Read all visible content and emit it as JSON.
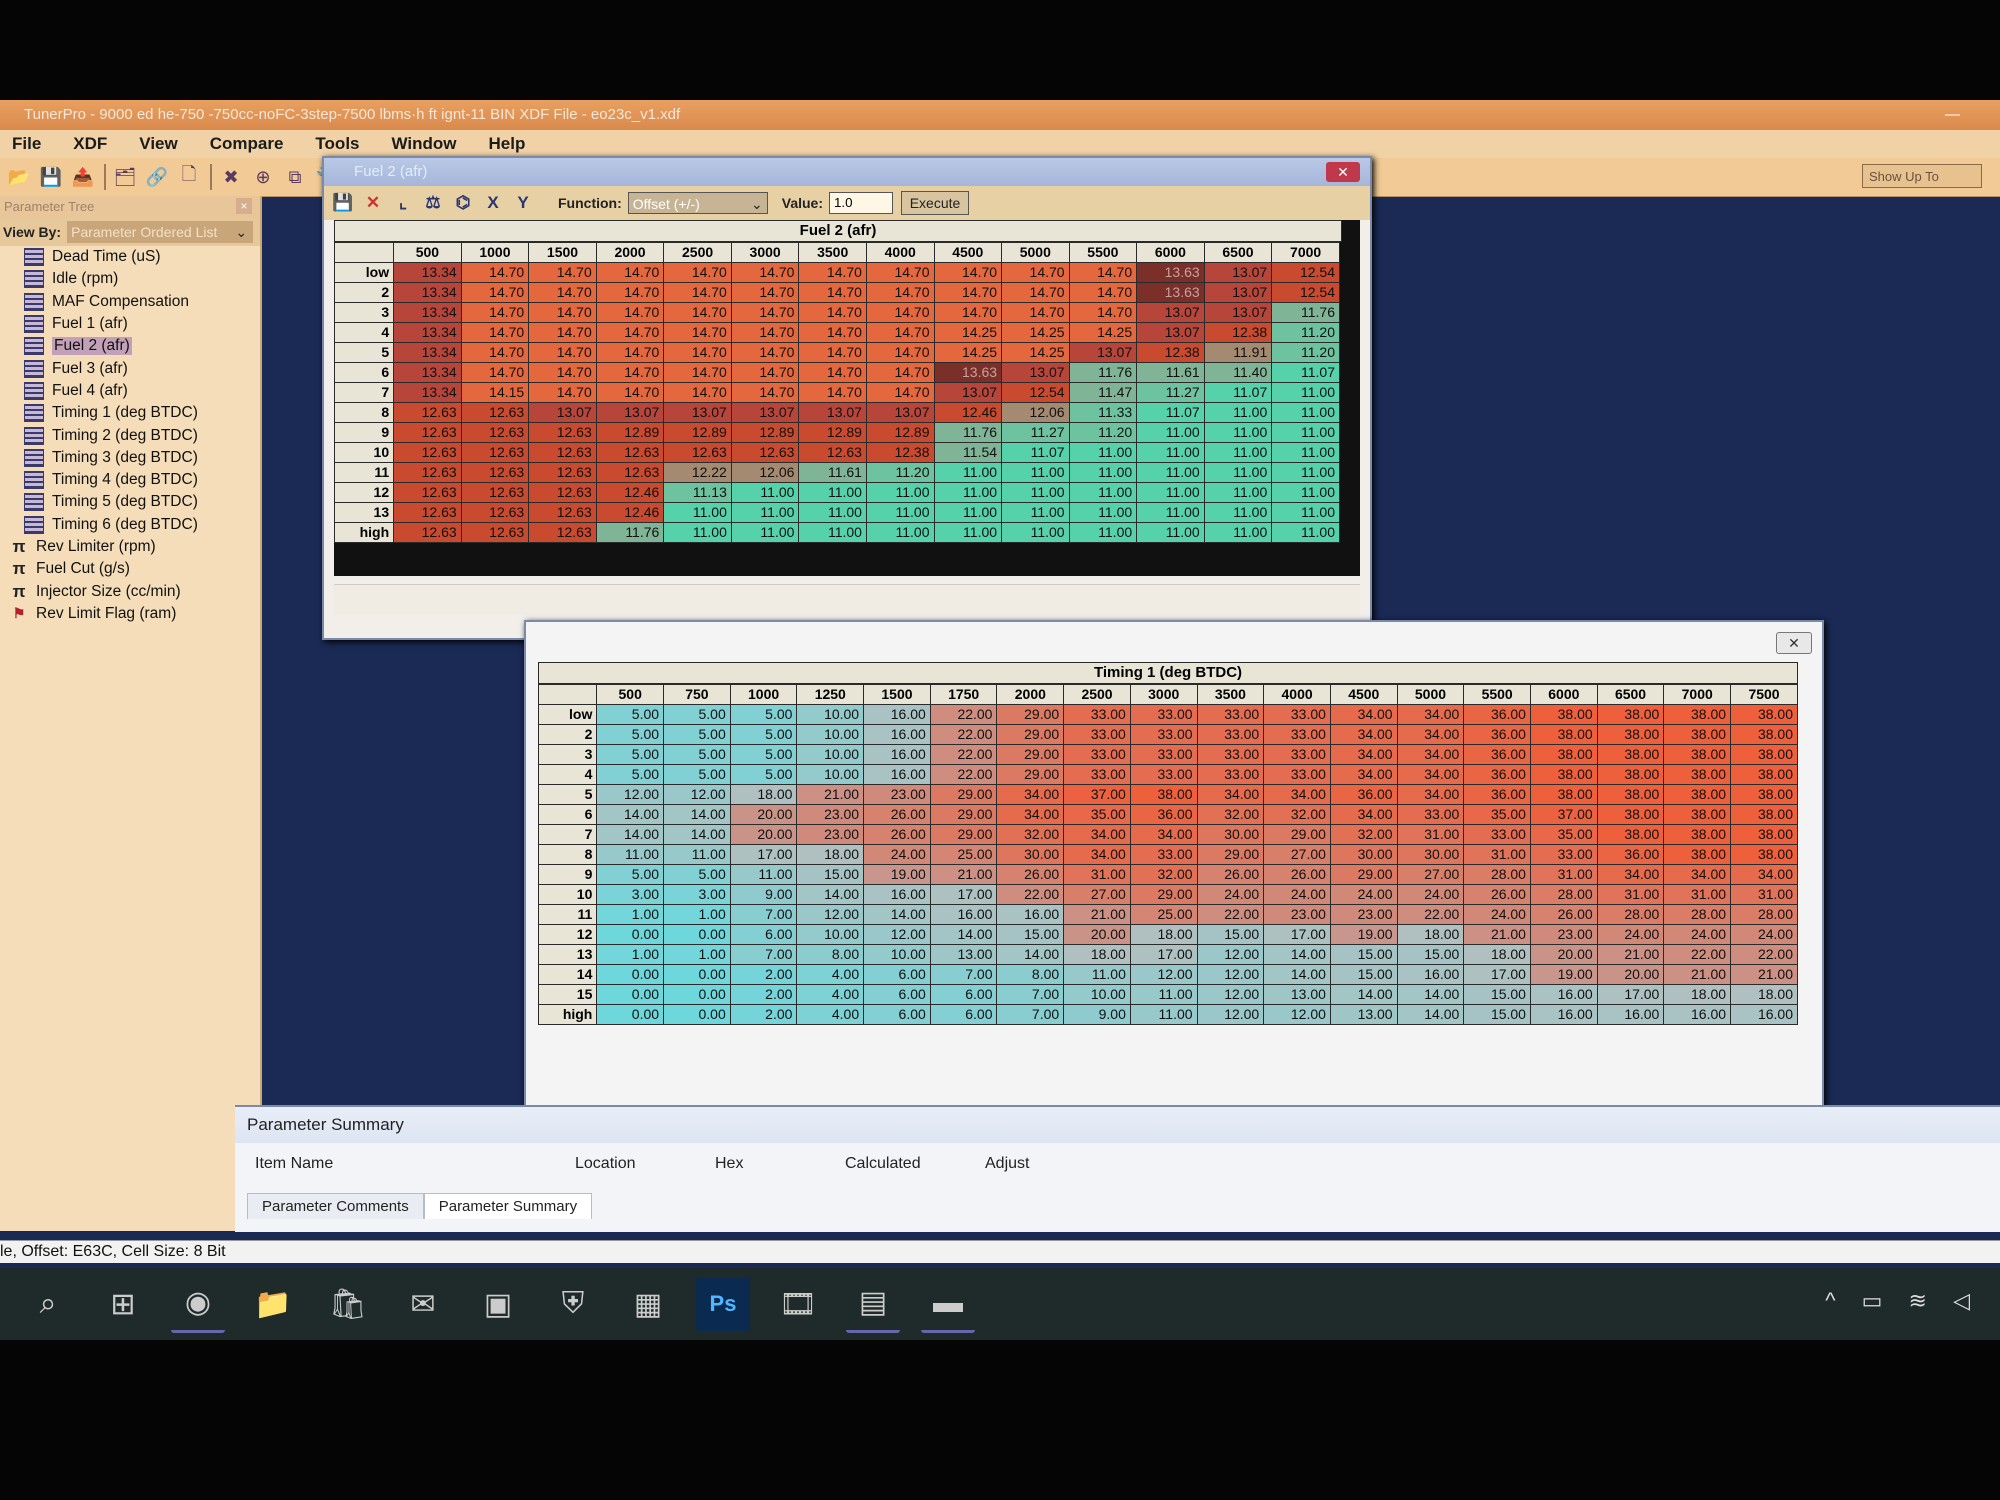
{
  "app": {
    "title": "TunerPro - 9000 ed  he-750 -750cc-noFC-3step-7500 lbms·h ft ignt-11 BIN  XDF File - eo23c_v1.xdf",
    "minimize": "—"
  },
  "menu": [
    "File",
    "XDF",
    "View",
    "Compare",
    "Tools",
    "Window",
    "Help"
  ],
  "toolbar": {
    "icons": [
      "open-icon",
      "save-icon",
      "export-icon",
      "sep",
      "import-icon",
      "link-icon",
      "new-icon",
      "sep",
      "delete-icon",
      "add-icon",
      "copy-icon",
      "wrench-icon",
      "page-icon",
      "sep",
      "table-view-icon",
      "list-view-icon",
      "window-icon",
      "monitor-icon",
      "sep",
      "counter-icon",
      "search-icon",
      "compare-icon",
      "grid-icon",
      "chip-icon"
    ],
    "glyphs": [
      "📂",
      "💾",
      "📤",
      "|",
      "🗂",
      "🔗",
      "🗋",
      "|",
      "✖",
      "⊕",
      "⧉",
      "🔧",
      "🗍",
      "|",
      "▦",
      "☰",
      "▣",
      "🖥",
      "|",
      "▤",
      "🔍",
      "⚖",
      "▩",
      "▥"
    ],
    "show_up_to": "Show Up To"
  },
  "sidebar": {
    "title": "Parameter Tree",
    "close": "×",
    "view_by_label": "View By:",
    "view_by_value": "Parameter Ordered List",
    "items": [
      {
        "label": "Dead Time (uS)",
        "type": "table"
      },
      {
        "label": "Idle (rpm)",
        "type": "table"
      },
      {
        "label": "MAF Compensation",
        "type": "table"
      },
      {
        "label": "Fuel 1 (afr)",
        "type": "table"
      },
      {
        "label": "Fuel 2 (afr)",
        "type": "table",
        "selected": true
      },
      {
        "label": "Fuel 3 (afr)",
        "type": "table"
      },
      {
        "label": "Fuel 4 (afr)",
        "type": "table"
      },
      {
        "label": "Timing 1 (deg BTDC)",
        "type": "table"
      },
      {
        "label": "Timing 2 (deg BTDC)",
        "type": "table"
      },
      {
        "label": "Timing 3 (deg BTDC)",
        "type": "table"
      },
      {
        "label": "Timing 4 (deg BTDC)",
        "type": "table"
      },
      {
        "label": "Timing 5 (deg BTDC)",
        "type": "table"
      },
      {
        "label": "Timing 6 (deg BTDC)",
        "type": "table"
      },
      {
        "label": "Rev Limiter (rpm)",
        "type": "constant"
      },
      {
        "label": "Fuel Cut (g/s)",
        "type": "constant"
      },
      {
        "label": "Injector Size (cc/min)",
        "type": "constant"
      },
      {
        "label": "Rev Limit Flag (ram)",
        "type": "flag"
      }
    ]
  },
  "fuel_window": {
    "title": "Fuel 2 (afr)",
    "close": "✕",
    "function_label": "Function:",
    "function_value": "Offset (+/-)",
    "value_label": "Value:",
    "value": "1.0",
    "execute": "Execute",
    "table_title": "Fuel 2 (afr)",
    "columns": [
      "500",
      "1000",
      "1500",
      "2000",
      "2500",
      "3000",
      "3500",
      "4000",
      "4500",
      "5000",
      "5500",
      "6000",
      "6500",
      "7000"
    ],
    "rows": [
      {
        "label": "low",
        "cells": [
          "13.34",
          "14.70",
          "14.70",
          "14.70",
          "14.70",
          "14.70",
          "14.70",
          "14.70",
          "14.70",
          "14.70",
          "14.70",
          "13.63",
          "13.07",
          "12.54"
        ]
      },
      {
        "label": "2",
        "cells": [
          "13.34",
          "14.70",
          "14.70",
          "14.70",
          "14.70",
          "14.70",
          "14.70",
          "14.70",
          "14.70",
          "14.70",
          "14.70",
          "13.63",
          "13.07",
          "12.54"
        ]
      },
      {
        "label": "3",
        "cells": [
          "13.34",
          "14.70",
          "14.70",
          "14.70",
          "14.70",
          "14.70",
          "14.70",
          "14.70",
          "14.70",
          "14.70",
          "14.70",
          "13.07",
          "13.07",
          "11.76"
        ]
      },
      {
        "label": "4",
        "cells": [
          "13.34",
          "14.70",
          "14.70",
          "14.70",
          "14.70",
          "14.70",
          "14.70",
          "14.70",
          "14.25",
          "14.25",
          "14.25",
          "13.07",
          "12.38",
          "11.20"
        ]
      },
      {
        "label": "5",
        "cells": [
          "13.34",
          "14.70",
          "14.70",
          "14.70",
          "14.70",
          "14.70",
          "14.70",
          "14.70",
          "14.25",
          "14.25",
          "13.07",
          "12.38",
          "11.91",
          "11.20"
        ]
      },
      {
        "label": "6",
        "cells": [
          "13.34",
          "14.70",
          "14.70",
          "14.70",
          "14.70",
          "14.70",
          "14.70",
          "14.70",
          "13.63",
          "13.07",
          "11.76",
          "11.61",
          "11.40",
          "11.07"
        ]
      },
      {
        "label": "7",
        "cells": [
          "13.34",
          "14.15",
          "14.70",
          "14.70",
          "14.70",
          "14.70",
          "14.70",
          "14.70",
          "13.07",
          "12.54",
          "11.47",
          "11.27",
          "11.07",
          "11.00"
        ]
      },
      {
        "label": "8",
        "cells": [
          "12.63",
          "12.63",
          "13.07",
          "13.07",
          "13.07",
          "13.07",
          "13.07",
          "13.07",
          "12.46",
          "12.06",
          "11.33",
          "11.07",
          "11.00",
          "11.00"
        ]
      },
      {
        "label": "9",
        "cells": [
          "12.63",
          "12.63",
          "12.63",
          "12.89",
          "12.89",
          "12.89",
          "12.89",
          "12.89",
          "11.76",
          "11.27",
          "11.20",
          "11.00",
          "11.00",
          "11.00"
        ]
      },
      {
        "label": "10",
        "cells": [
          "12.63",
          "12.63",
          "12.63",
          "12.63",
          "12.63",
          "12.63",
          "12.63",
          "12.38",
          "11.54",
          "11.07",
          "11.00",
          "11.00",
          "11.00",
          "11.00"
        ]
      },
      {
        "label": "11",
        "cells": [
          "12.63",
          "12.63",
          "12.63",
          "12.63",
          "12.22",
          "12.06",
          "11.61",
          "11.20",
          "11.00",
          "11.00",
          "11.00",
          "11.00",
          "11.00",
          "11.00"
        ]
      },
      {
        "label": "12",
        "cells": [
          "12.63",
          "12.63",
          "12.63",
          "12.46",
          "11.13",
          "11.00",
          "11.00",
          "11.00",
          "11.00",
          "11.00",
          "11.00",
          "11.00",
          "11.00",
          "11.00"
        ]
      },
      {
        "label": "13",
        "cells": [
          "12.63",
          "12.63",
          "12.63",
          "12.46",
          "11.00",
          "11.00",
          "11.00",
          "11.00",
          "11.00",
          "11.00",
          "11.00",
          "11.00",
          "11.00",
          "11.00"
        ]
      },
      {
        "label": "high",
        "cells": [
          "12.63",
          "12.63",
          "12.63",
          "11.76",
          "11.00",
          "11.00",
          "11.00",
          "11.00",
          "11.00",
          "11.00",
          "11.00",
          "11.00",
          "11.00",
          "11.00"
        ]
      }
    ]
  },
  "timing_window": {
    "close": "✕",
    "table_title": "Timing 1 (deg BTDC)",
    "columns": [
      "500",
      "750",
      "1000",
      "1250",
      "1500",
      "1750",
      "2000",
      "2500",
      "3000",
      "3500",
      "4000",
      "4500",
      "5000",
      "5500",
      "6000",
      "6500",
      "7000",
      "7500"
    ],
    "rows": [
      {
        "label": "low",
        "cells": [
          "5.00",
          "5.00",
          "5.00",
          "10.00",
          "16.00",
          "22.00",
          "29.00",
          "33.00",
          "33.00",
          "33.00",
          "33.00",
          "34.00",
          "34.00",
          "36.00",
          "38.00",
          "38.00",
          "38.00",
          "38.00"
        ]
      },
      {
        "label": "2",
        "cells": [
          "5.00",
          "5.00",
          "5.00",
          "10.00",
          "16.00",
          "22.00",
          "29.00",
          "33.00",
          "33.00",
          "33.00",
          "33.00",
          "34.00",
          "34.00",
          "36.00",
          "38.00",
          "38.00",
          "38.00",
          "38.00"
        ]
      },
      {
        "label": "3",
        "cells": [
          "5.00",
          "5.00",
          "5.00",
          "10.00",
          "16.00",
          "22.00",
          "29.00",
          "33.00",
          "33.00",
          "33.00",
          "33.00",
          "34.00",
          "34.00",
          "36.00",
          "38.00",
          "38.00",
          "38.00",
          "38.00"
        ]
      },
      {
        "label": "4",
        "cells": [
          "5.00",
          "5.00",
          "5.00",
          "10.00",
          "16.00",
          "22.00",
          "29.00",
          "33.00",
          "33.00",
          "33.00",
          "33.00",
          "34.00",
          "34.00",
          "36.00",
          "38.00",
          "38.00",
          "38.00",
          "38.00"
        ]
      },
      {
        "label": "5",
        "cells": [
          "12.00",
          "12.00",
          "18.00",
          "21.00",
          "23.00",
          "29.00",
          "34.00",
          "37.00",
          "38.00",
          "34.00",
          "34.00",
          "36.00",
          "34.00",
          "36.00",
          "38.00",
          "38.00",
          "38.00",
          "38.00"
        ]
      },
      {
        "label": "6",
        "cells": [
          "14.00",
          "14.00",
          "20.00",
          "23.00",
          "26.00",
          "29.00",
          "34.00",
          "35.00",
          "36.00",
          "32.00",
          "32.00",
          "34.00",
          "33.00",
          "35.00",
          "37.00",
          "38.00",
          "38.00",
          "38.00"
        ]
      },
      {
        "label": "7",
        "cells": [
          "14.00",
          "14.00",
          "20.00",
          "23.00",
          "26.00",
          "29.00",
          "32.00",
          "34.00",
          "34.00",
          "30.00",
          "29.00",
          "32.00",
          "31.00",
          "33.00",
          "35.00",
          "38.00",
          "38.00",
          "38.00"
        ]
      },
      {
        "label": "8",
        "cells": [
          "11.00",
          "11.00",
          "17.00",
          "18.00",
          "24.00",
          "25.00",
          "30.00",
          "34.00",
          "33.00",
          "29.00",
          "27.00",
          "30.00",
          "30.00",
          "31.00",
          "33.00",
          "36.00",
          "38.00",
          "38.00"
        ]
      },
      {
        "label": "9",
        "cells": [
          "5.00",
          "5.00",
          "11.00",
          "15.00",
          "19.00",
          "21.00",
          "26.00",
          "31.00",
          "32.00",
          "26.00",
          "26.00",
          "29.00",
          "27.00",
          "28.00",
          "31.00",
          "34.00",
          "34.00",
          "34.00"
        ]
      },
      {
        "label": "10",
        "cells": [
          "3.00",
          "3.00",
          "9.00",
          "14.00",
          "16.00",
          "17.00",
          "22.00",
          "27.00",
          "29.00",
          "24.00",
          "24.00",
          "24.00",
          "24.00",
          "26.00",
          "28.00",
          "31.00",
          "31.00",
          "31.00"
        ]
      },
      {
        "label": "11",
        "cells": [
          "1.00",
          "1.00",
          "7.00",
          "12.00",
          "14.00",
          "16.00",
          "16.00",
          "21.00",
          "25.00",
          "22.00",
          "23.00",
          "23.00",
          "22.00",
          "24.00",
          "26.00",
          "28.00",
          "28.00",
          "28.00"
        ]
      },
      {
        "label": "12",
        "cells": [
          "0.00",
          "0.00",
          "6.00",
          "10.00",
          "12.00",
          "14.00",
          "15.00",
          "20.00",
          "18.00",
          "15.00",
          "17.00",
          "19.00",
          "18.00",
          "21.00",
          "23.00",
          "24.00",
          "24.00",
          "24.00"
        ]
      },
      {
        "label": "13",
        "cells": [
          "1.00",
          "1.00",
          "7.00",
          "8.00",
          "10.00",
          "13.00",
          "14.00",
          "18.00",
          "17.00",
          "12.00",
          "14.00",
          "15.00",
          "15.00",
          "18.00",
          "20.00",
          "21.00",
          "22.00",
          "22.00"
        ]
      },
      {
        "label": "14",
        "cells": [
          "0.00",
          "0.00",
          "2.00",
          "4.00",
          "6.00",
          "7.00",
          "8.00",
          "11.00",
          "12.00",
          "12.00",
          "14.00",
          "15.00",
          "16.00",
          "17.00",
          "19.00",
          "20.00",
          "21.00",
          "21.00"
        ]
      },
      {
        "label": "15",
        "cells": [
          "0.00",
          "0.00",
          "2.00",
          "4.00",
          "6.00",
          "6.00",
          "7.00",
          "10.00",
          "11.00",
          "12.00",
          "13.00",
          "14.00",
          "14.00",
          "15.00",
          "16.00",
          "17.00",
          "18.00",
          "18.00"
        ]
      },
      {
        "label": "high",
        "cells": [
          "0.00",
          "0.00",
          "2.00",
          "4.00",
          "6.00",
          "6.00",
          "7.00",
          "9.00",
          "11.00",
          "12.00",
          "12.00",
          "13.00",
          "14.00",
          "15.00",
          "16.00",
          "16.00",
          "16.00",
          "16.00"
        ]
      }
    ]
  },
  "summary": {
    "title": "Parameter Summary",
    "columns": [
      "Item Name",
      "Location",
      "Hex",
      "Calculated",
      "Adjust"
    ],
    "tabs": [
      "Parameter Comments",
      "Parameter Summary"
    ]
  },
  "status": "le, Offset: E63C,  Cell Size: 8 Bit",
  "taskbar": {
    "apps": [
      "search-icon",
      "task-view-icon",
      "edge-icon",
      "file-explorer-icon",
      "store-icon",
      "mail-icon",
      "minecraft-icon",
      "world-of-tanks-icon",
      "calculator-icon",
      "photoshop-icon",
      "video-editor-icon",
      "winrar-icon",
      "tunerpro-icon"
    ],
    "glyphs": [
      "⌕",
      "⊞",
      "◉",
      "📁",
      "🛍",
      "✉",
      "▣",
      "⛨",
      "▦",
      "Ps",
      "🎞",
      "▤",
      "▬"
    ],
    "tray": "^ ▭ ≋ ◁"
  }
}
